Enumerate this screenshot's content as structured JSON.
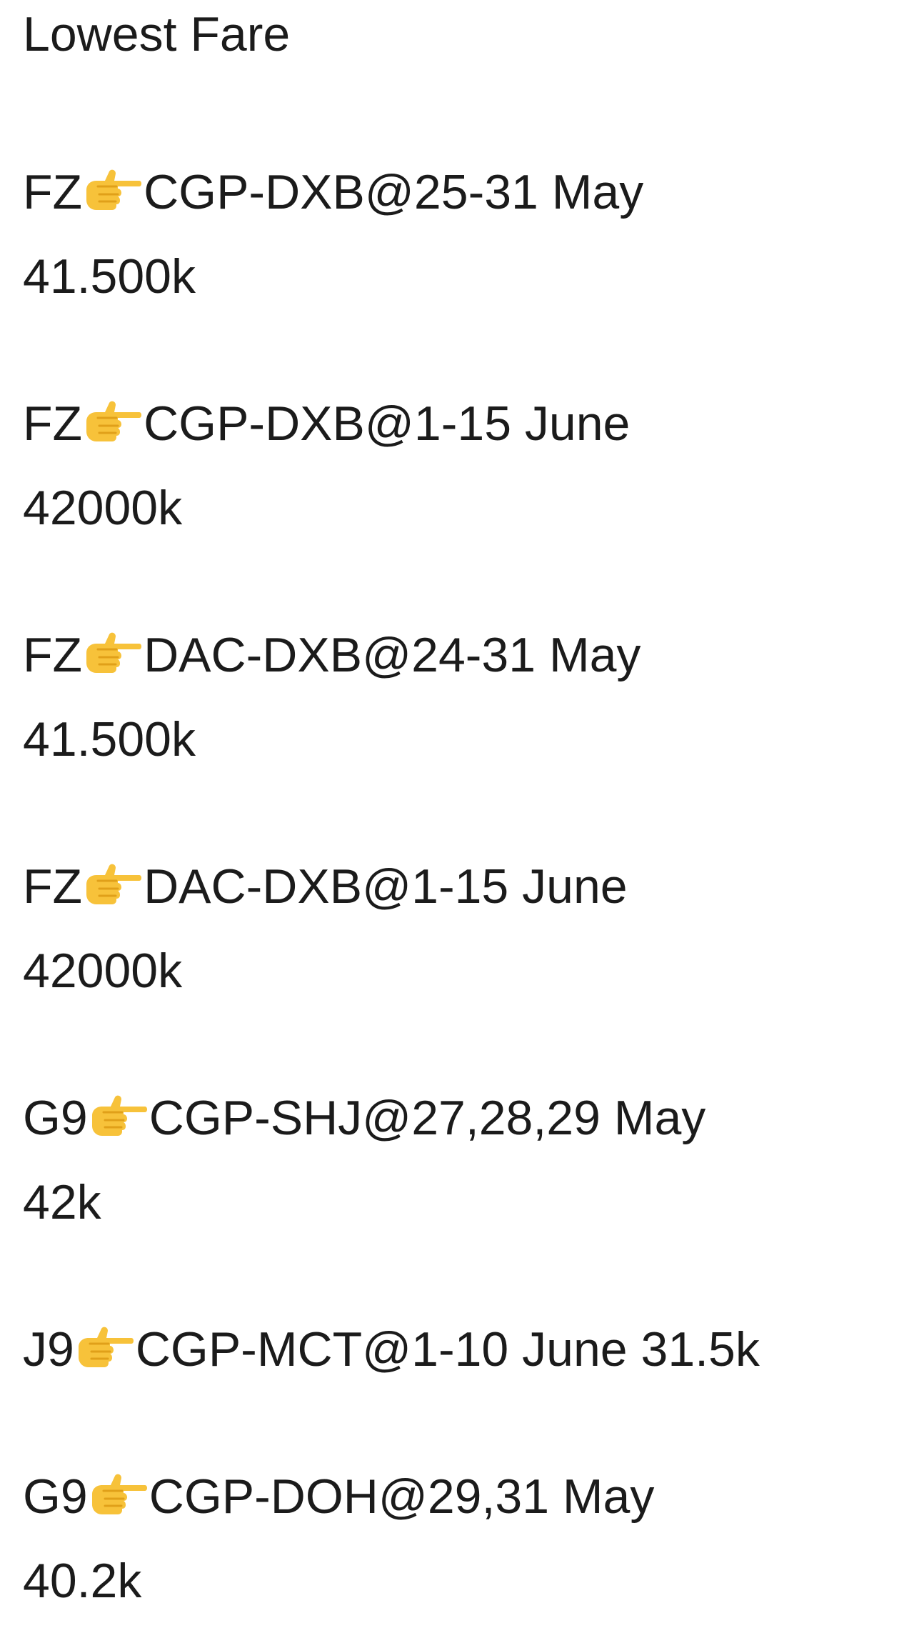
{
  "message": {
    "title": "Lowest Fare",
    "fares": [
      {
        "airline": "FZ",
        "route_dates": "CGP-DXB@25-31 May",
        "price": "41.500k"
      },
      {
        "airline": "FZ",
        "route_dates": "CGP-DXB@1-15 June",
        "price": "42000k"
      },
      {
        "airline": "FZ",
        "route_dates": "DAC-DXB@24-31 May",
        "price": "41.500k"
      },
      {
        "airline": "FZ",
        "route_dates": "DAC-DXB@1-15 June",
        "price": "42000k"
      },
      {
        "airline": "G9",
        "route_dates": "CGP-SHJ@27,28,29 May",
        "price": "42k"
      },
      {
        "airline": "J9",
        "route_dates": "CGP-MCT@1-10 June",
        "price": "31.5k"
      },
      {
        "airline": "G9",
        "route_dates": "CGP-DOH@29,31 May",
        "price": "40.2k"
      }
    ],
    "pointer_icon": "pointing-right-hand-emoji",
    "colors": {
      "text": "#1b1b1b",
      "emoji_skin": "#f7c23a",
      "emoji_shade": "#e0a019"
    }
  }
}
